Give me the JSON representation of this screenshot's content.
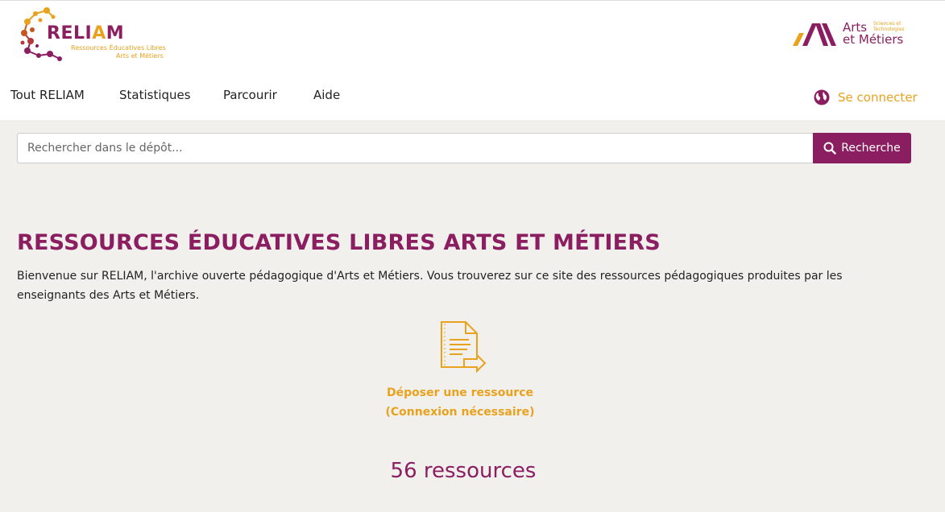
{
  "header": {
    "logo_left": {
      "brand_prefix": "RELI",
      "brand_highlight": "A",
      "brand_suffix": "M",
      "tagline_line1": "Ressources Éducatives Libres",
      "tagline_line2": "Arts et Métiers"
    },
    "logo_right": {
      "line1": "Arts",
      "line2": "et Métiers",
      "small_line1": "Sciences et",
      "small_line2": "Technologies"
    }
  },
  "nav": {
    "items": [
      {
        "label": "Tout RELIAM"
      },
      {
        "label": "Statistiques"
      },
      {
        "label": "Parcourir"
      },
      {
        "label": "Aide"
      }
    ],
    "login_label": "Se connecter"
  },
  "search": {
    "placeholder": "Rechercher dans le dépôt...",
    "value": "",
    "button_label": "Recherche"
  },
  "main": {
    "title": "RESSOURCES ÉDUCATIVES LIBRES ARTS ET MÉTIERS",
    "intro": "Bienvenue sur RELIAM, l'archive ouverte pédagogique d'Arts et Métiers. Vous trouverez sur ce site des ressources pédagogiques produites par les enseignants des Arts et Métiers.",
    "deposit_line1": "Déposer une ressource",
    "deposit_line2": "(Connexion nécessaire)",
    "count": "56 ressources"
  },
  "colors": {
    "brand": "#8b1e61",
    "accent": "#e8a21e",
    "background": "#f2f0ed"
  }
}
